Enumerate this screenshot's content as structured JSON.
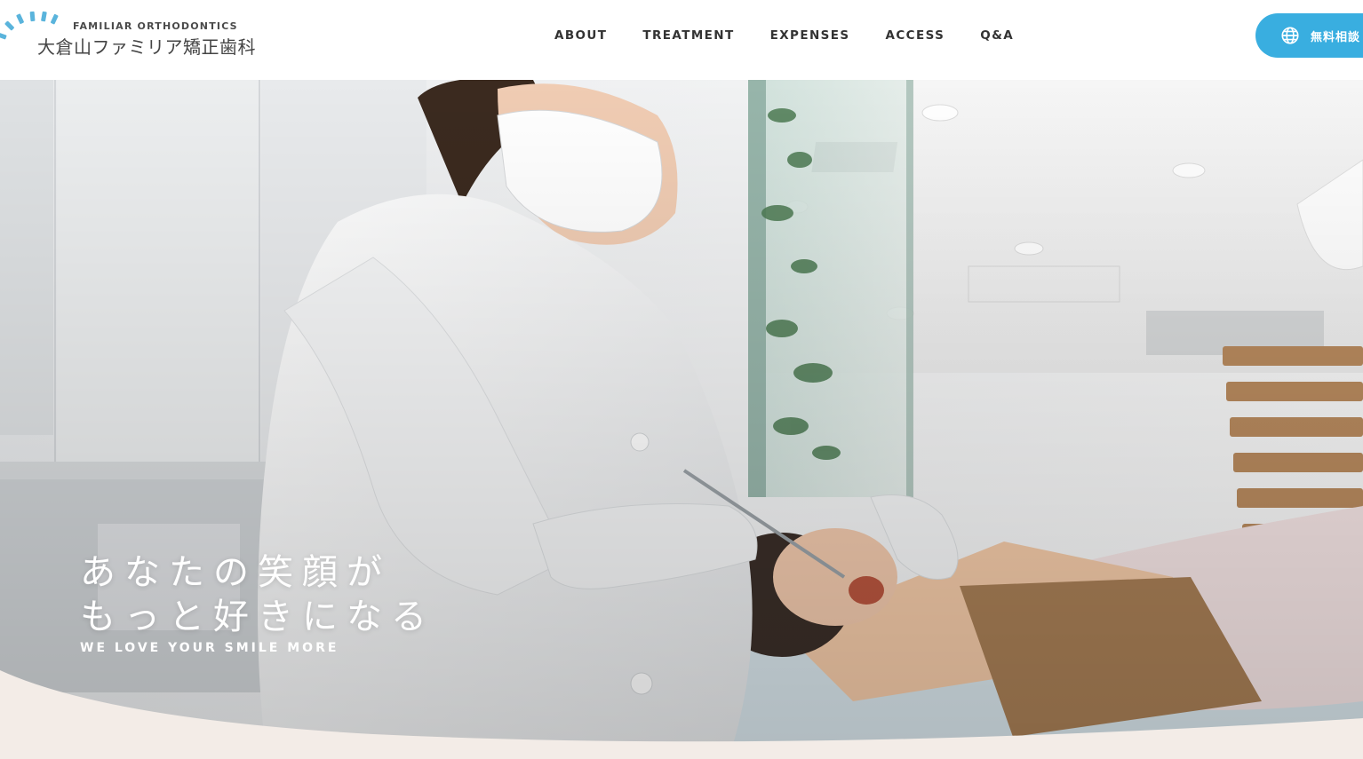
{
  "header": {
    "logo": {
      "name_en": "FAMILIAR ORTHODONTICS",
      "name_ja": "大倉山ファミリア矯正歯科"
    },
    "nav": [
      {
        "label": "ABOUT"
      },
      {
        "label": "TREATMENT"
      },
      {
        "label": "EXPENSES"
      },
      {
        "label": "ACCESS"
      },
      {
        "label": "Q&A"
      }
    ],
    "consult_button": {
      "label": "無料相談",
      "icon": "globe-icon"
    }
  },
  "hero": {
    "headline_line1": "あなたの笑顔が",
    "headline_line2": "もっと好きになる",
    "subheadline": "WE LOVE YOUR SMILE MORE"
  },
  "colors": {
    "accent": "#39aee0",
    "logo_mark": "#5ab4dc",
    "wave": "#f3ece7",
    "nav_text": "#333333"
  }
}
